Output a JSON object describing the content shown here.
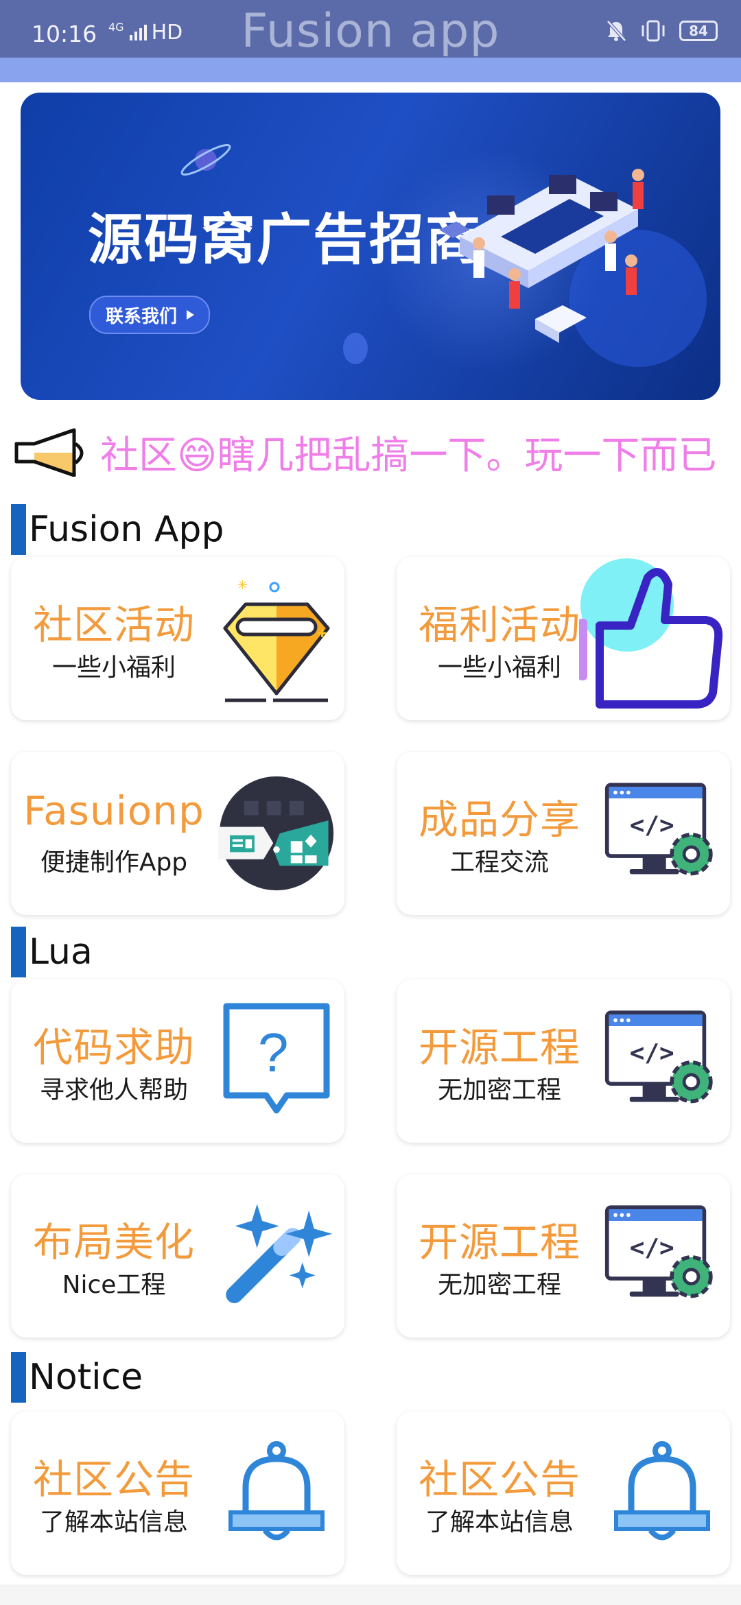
{
  "status_bar": {
    "time": "10:16",
    "network": "4G",
    "hd": "HD",
    "battery": "84"
  },
  "app": {
    "title": "Fusion app"
  },
  "banner": {
    "title": "源码窝广告招商",
    "cta": "联系我们"
  },
  "marquee": {
    "text": "社区😄瞎几把乱搞一下。玩一下而已"
  },
  "sections": [
    {
      "title": "Fusion App",
      "cards": [
        {
          "title": "社区活动",
          "subtitle": "一些小福利",
          "icon": "diamond-icon"
        },
        {
          "title": "福利活动",
          "subtitle": "一些小福利",
          "icon": "thumbs-up-icon"
        },
        {
          "title": "Fasuionp",
          "subtitle": "便捷制作App",
          "icon": "app-builder-icon"
        },
        {
          "title": "成品分享",
          "subtitle": "工程交流",
          "icon": "code-monitor-icon"
        }
      ]
    },
    {
      "title": "Lua",
      "cards": [
        {
          "title": "代码求助",
          "subtitle": "寻求他人帮助",
          "icon": "question-bubble-icon"
        },
        {
          "title": "开源工程",
          "subtitle": "无加密工程",
          "icon": "code-monitor-icon"
        },
        {
          "title": "布局美化",
          "subtitle": "Nice工程",
          "icon": "magic-wand-icon"
        },
        {
          "title": "开源工程",
          "subtitle": "无加密工程",
          "icon": "code-monitor-icon"
        }
      ]
    },
    {
      "title": "Notice",
      "cards": [
        {
          "title": "社区公告",
          "subtitle": "了解本站信息",
          "icon": "bell-icon"
        },
        {
          "title": "社区公告",
          "subtitle": "了解本站信息",
          "icon": "bell-icon"
        }
      ]
    }
  ],
  "colors": {
    "title_bar": "#5b6aa8",
    "accent_strip": "#8aa3ee",
    "section_bar": "#1565c0",
    "card_title": "#f39b3c",
    "marquee_text": "#f07ee8"
  }
}
